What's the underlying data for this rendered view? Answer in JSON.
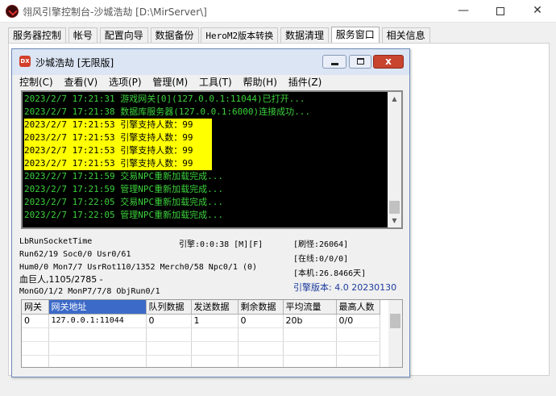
{
  "app": {
    "title": "翎风引擎控制台-沙城浩劫 [D:\\MirServer\\]",
    "minimize": "—",
    "maximize": "",
    "close": "✕"
  },
  "tabs": [
    {
      "label": "服务器控制"
    },
    {
      "label": "帐号"
    },
    {
      "label": "配置向导"
    },
    {
      "label": "数据备份"
    },
    {
      "label": "HeroM2版本转换"
    },
    {
      "label": "数据清理"
    },
    {
      "label": "服务窗口"
    },
    {
      "label": "相关信息"
    }
  ],
  "inner_window": {
    "icon_text": "DX",
    "title": "沙城浩劫 [无限版]",
    "close": "x",
    "menus": [
      "控制(C)",
      "查看(V)",
      "选项(P)",
      "管理(M)",
      "工具(T)",
      "帮助(H)",
      "插件(Z)"
    ]
  },
  "log": [
    {
      "text": "2023/2/7 17:21:31 游戏网关[0](127.0.0.1:11044)已打开...",
      "highlight": false
    },
    {
      "text": "2023/2/7 17:21:38 数据库服务器(127.0.0.1:6000)连接成功...",
      "highlight": false
    },
    {
      "text": "2023/2/7 17:21:53 引擎支持人数：99",
      "highlight": true
    },
    {
      "text": "2023/2/7 17:21:53 引擎支持人数：99",
      "highlight": true
    },
    {
      "text": "2023/2/7 17:21:53 引擎支持人数：99",
      "highlight": true
    },
    {
      "text": "2023/2/7 17:21:53 引擎支持人数：99",
      "highlight": true
    },
    {
      "text": "2023/2/7 17:21:59 交易NPC重新加载完成...",
      "highlight": false
    },
    {
      "text": "2023/2/7 17:21:59 管理NPC重新加载完成...",
      "highlight": false
    },
    {
      "text": "2023/2/7 17:22:05 交易NPC重新加载完成...",
      "highlight": false
    },
    {
      "text": "2023/2/7 17:22:05 管理NPC重新加载完成...",
      "highlight": false
    }
  ],
  "status": {
    "socket_time": "LbRunSocketTime",
    "engine_time": "引擎:0:0:38 [M][F]",
    "monsters": "[刷怪:26064]",
    "run": "Run62/19 Soc0/0 Usr0/61",
    "online": "[在线:0/0/0]",
    "hum": "Hum0/0 Mon7/7 UsrRot110/1352 Merch0/58 Npc0/1 (0)",
    "local": "[本机:26.8466天]",
    "boss": "血巨人,1105/2785 -",
    "version": "引擎版本: 4.0 20230130",
    "mongo": "MonGO/1/2 MonP7/7/8 ObjRun0/1"
  },
  "grid": {
    "columns": [
      "网关",
      "网关地址",
      "队列数据",
      "发送数据",
      "剩余数据",
      "平均流量",
      "最高人数"
    ],
    "rows": [
      [
        "0",
        "127.0.0.1:11044",
        "0",
        "1",
        "0",
        "20b",
        "0/0"
      ]
    ],
    "empty_rows": 4
  },
  "colors": {
    "console_bg": "#000000",
    "console_text": "#3cd23c",
    "highlight_bg": "#ffff00",
    "version_text": "#1c3c9e",
    "selected_header": "#3c6ac8"
  }
}
